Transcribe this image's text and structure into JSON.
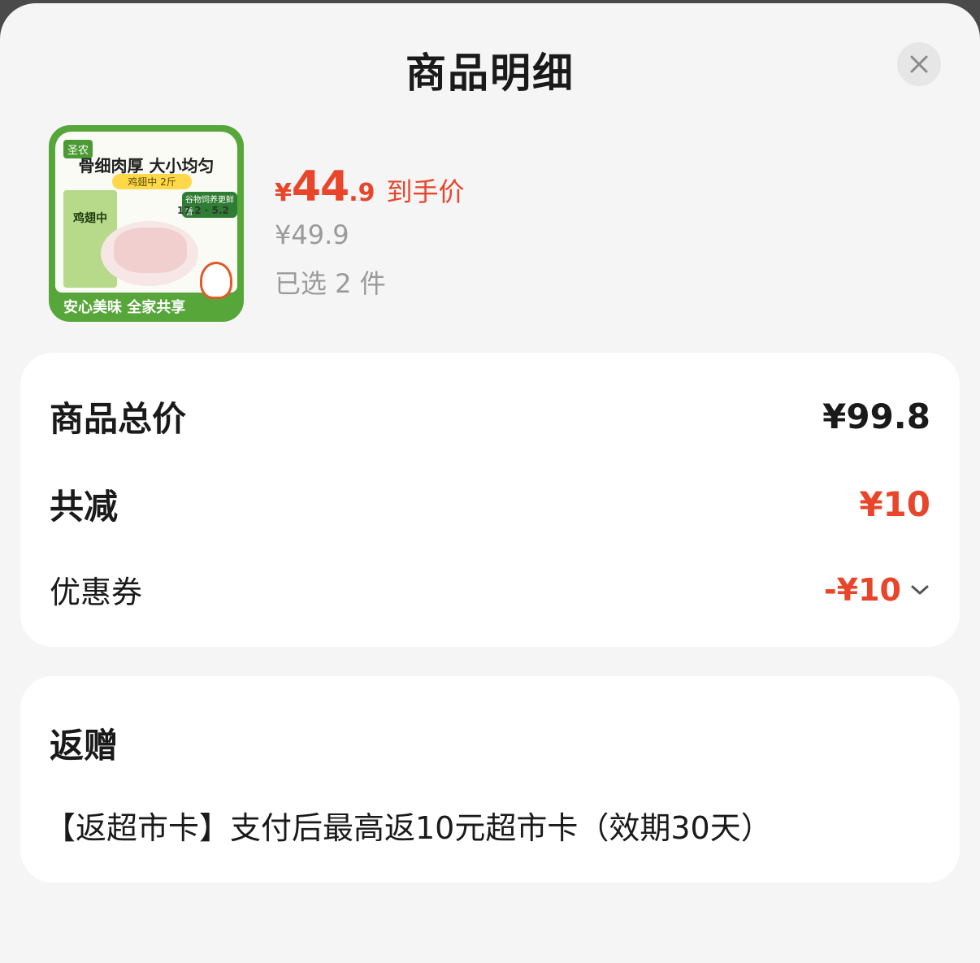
{
  "header": {
    "title": "商品明细"
  },
  "product": {
    "image": {
      "brand_tag": "圣农",
      "headline": "骨细肉厚 大小均匀",
      "subtitle": "鸡翅中 2斤",
      "pack_label": "鸡翅中",
      "badge": "谷物饲养更鲜香",
      "stats": "17.2 · 5.2",
      "bottom_text": "安心美味 全家共享"
    },
    "price_symbol": "¥",
    "price_int": "44",
    "price_dec": ".9",
    "price_label": "到手价",
    "original_price": "¥49.9",
    "selected": "已选 2 件"
  },
  "summary": {
    "total_label": "商品总价",
    "total_value": "¥99.8",
    "discount_label": "共减",
    "discount_value": "¥10",
    "coupon_label": "优惠券",
    "coupon_value": "-¥10"
  },
  "gift": {
    "title": "返赠",
    "text": "【返超市卡】支付后最高返10元超市卡（效期30天）"
  },
  "colors": {
    "accent": "#e8452a",
    "muted": "#9a9a9a",
    "brand_green": "#56a63a"
  }
}
